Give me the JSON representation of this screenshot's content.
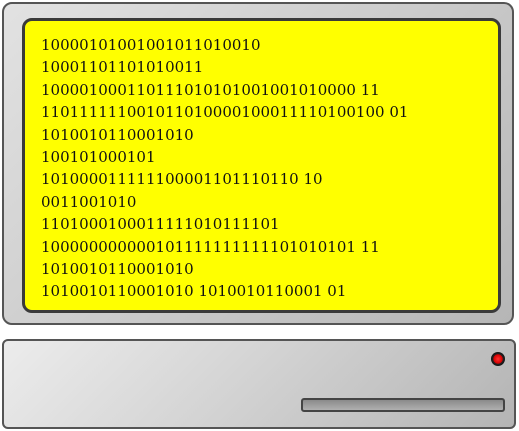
{
  "screen": {
    "background_color": "#ffff00",
    "lines": [
      "10000101001001011010010",
      "10001101101010011",
      "100001000110111010101001001010000 11",
      "110111111001011010000100011110100100 01",
      "1010010110001010",
      "100101000101",
      "101000011111100001101110110 10",
      "0011001010",
      "1101000100011111010111101",
      "100000000000101111111111101010101 11",
      "1010010110001010",
      "1010010110001010 1010010110001 01"
    ]
  },
  "base": {
    "power_led_color": "#e00000"
  }
}
